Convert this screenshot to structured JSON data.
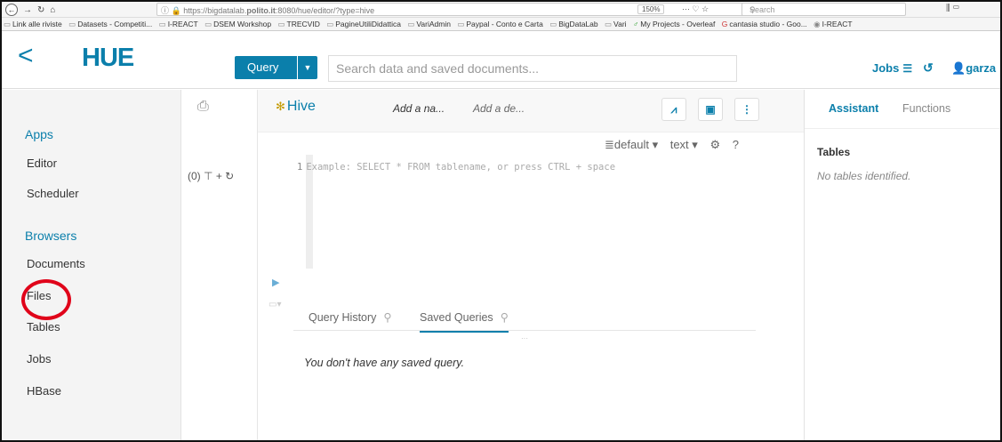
{
  "browser": {
    "url_prefix": "https://bigdatalab.",
    "url_domain": "polito.it",
    "url_suffix": ":8080/hue/editor/?type=hive",
    "zoom": "150%",
    "search_placeholder": "Search",
    "bookmarks": [
      "Link alle riviste",
      "Datasets - Competiti...",
      "I-REACT",
      "DSEM Workshop",
      "TRECVID",
      "PagineUtiliDidattica",
      "VariAdmin",
      "Paypal - Conto e Carta",
      "BigDataLab",
      "Vari",
      "My Projects - Overleaf",
      "cantasia studio - Goo...",
      "I-REACT"
    ]
  },
  "header": {
    "logo": "HUE",
    "query_label": "Query",
    "search_placeholder": "Search data and saved documents...",
    "jobs_label": "Jobs",
    "user_label": "garza"
  },
  "sidebar": {
    "apps_title": "Apps",
    "apps": [
      "Editor",
      "Scheduler"
    ],
    "browsers_title": "Browsers",
    "browsers": [
      "Documents",
      "Files",
      "Tables",
      "Jobs",
      "HBase"
    ],
    "highlighted": "Files"
  },
  "db_panel": {
    "count": "(0)"
  },
  "editor": {
    "title": "Hive",
    "name_placeholder": "Add a na...",
    "desc_placeholder": "Add a de...",
    "database": "default",
    "format": "text",
    "help": "?",
    "line_number": "1",
    "code_placeholder": "Example: SELECT * FROM tablename, or press CTRL + space",
    "tabs": [
      "Query History",
      "Saved Queries"
    ],
    "active_tab": "Saved Queries",
    "empty_message": "You don't have any saved query."
  },
  "assistant": {
    "tabs": [
      "Assistant",
      "Functions"
    ],
    "section": "Tables",
    "empty": "No tables identified."
  },
  "colors": {
    "accent": "#0b7fab",
    "highlight_circle": "#e0041a"
  }
}
